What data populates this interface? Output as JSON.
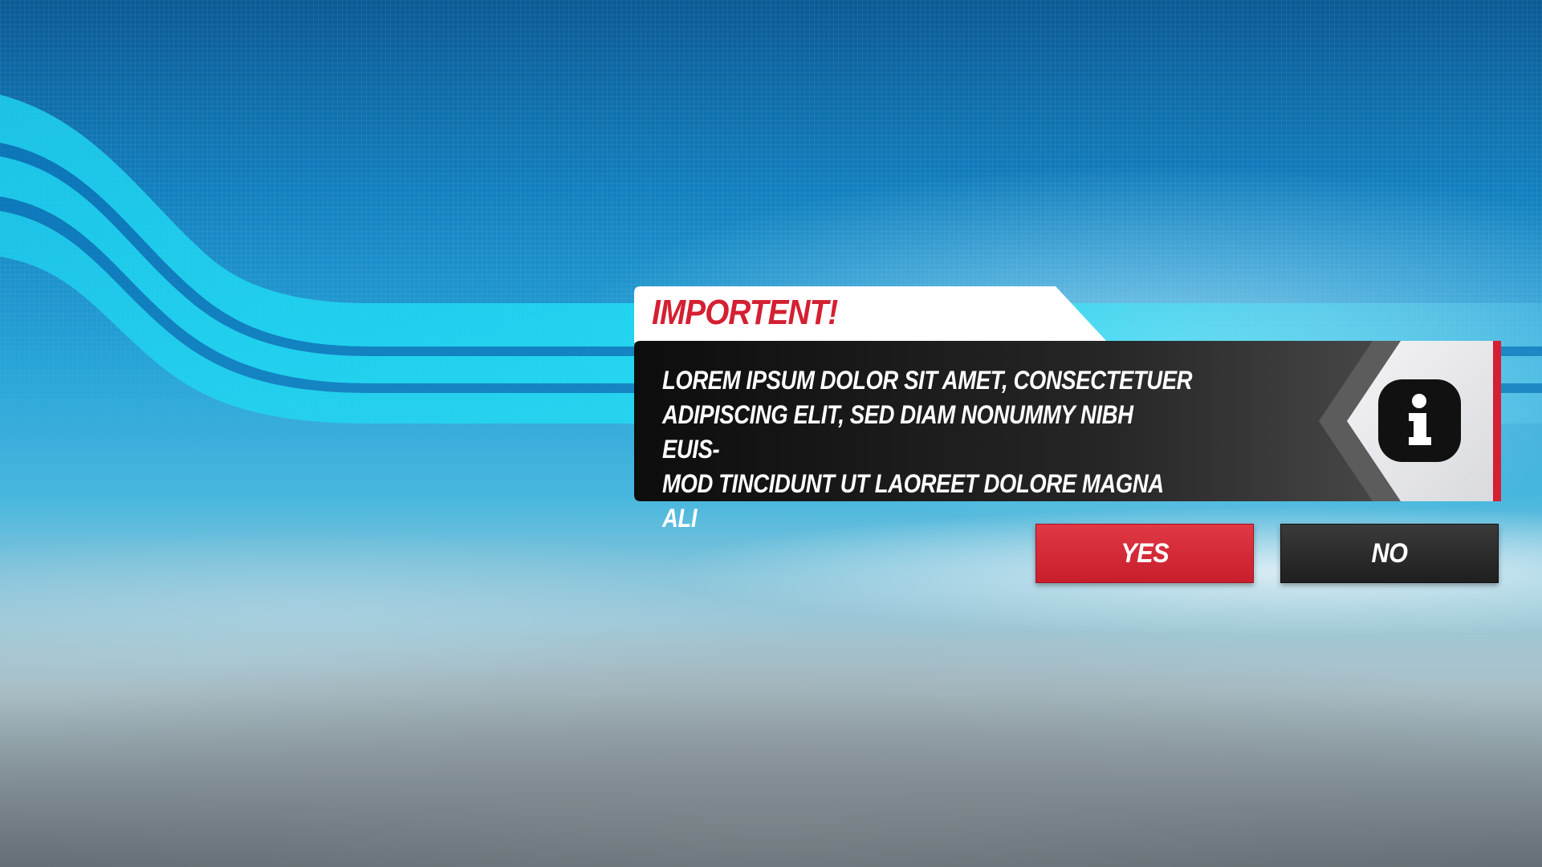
{
  "dialog": {
    "title": "IMPORTENT!",
    "message": "LOREM IPSUM DOLOR SIT AMET, CONSECTETUER\nADIPISCING ELIT, SED DIAM NONUMMY NIBH EUIS-\nMOD TINCIDUNT UT LAOREET DOLORE MAGNA ALI",
    "icon": "info-icon"
  },
  "buttons": {
    "yes_label": "YES",
    "no_label": "NO"
  },
  "colors": {
    "accent_red": "#d42032",
    "panel_dark": "#111111",
    "stripe_cyan": "#1ee0f5"
  }
}
